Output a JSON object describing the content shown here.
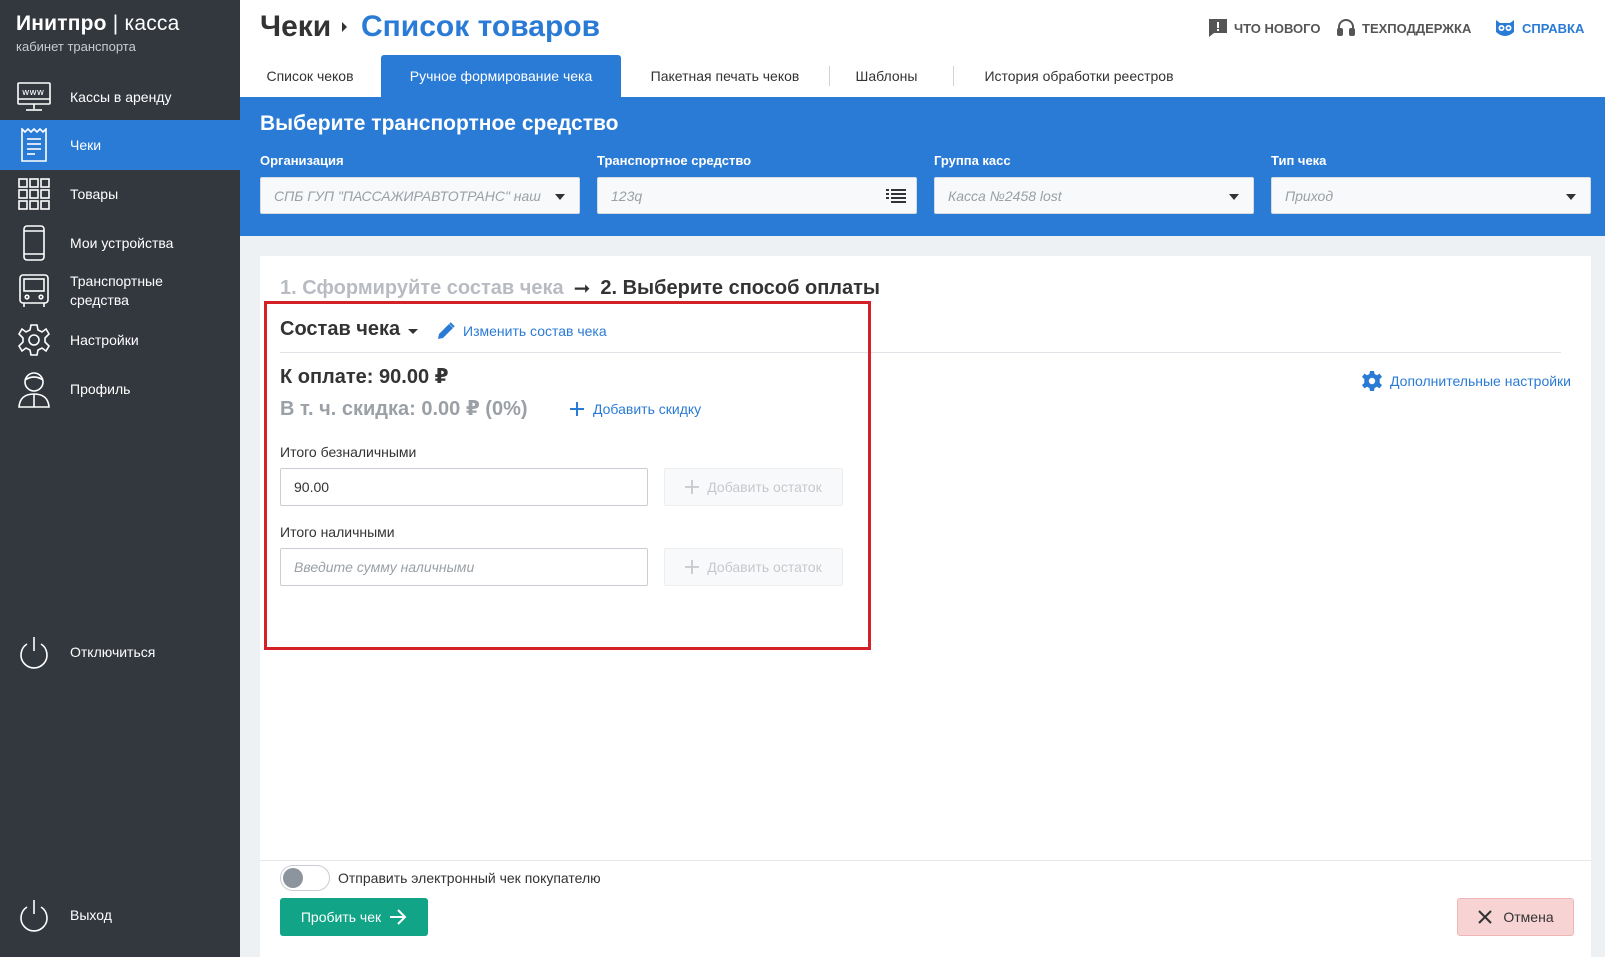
{
  "brand": {
    "name": "Инитпро",
    "separator": "|",
    "product": "касса",
    "subtitle": "кабинет транспорта"
  },
  "sidebar": {
    "items": [
      {
        "label": "Кассы в аренду",
        "icon": "www-monitor-icon"
      },
      {
        "label": "Чеки",
        "icon": "receipt-icon",
        "active": true
      },
      {
        "label": "Товары",
        "icon": "grid-icon"
      },
      {
        "label": "Мои устройства",
        "icon": "phone-icon"
      },
      {
        "label": "Транспортные средства",
        "icon": "bus-icon"
      },
      {
        "label": "Настройки",
        "icon": "gear-icon"
      },
      {
        "label": "Профиль",
        "icon": "user-icon"
      }
    ],
    "disconnect": "Отключиться",
    "logout": "Выход"
  },
  "header": {
    "breadcrumb_root": "Чеки",
    "breadcrumb_current": "Список товаров",
    "links": {
      "whats_new": "ЧТО НОВОГО",
      "support": "ТЕХПОДДЕРЖКА",
      "help": "СПРАВКА"
    }
  },
  "tabs": [
    {
      "label": "Список чеков"
    },
    {
      "label": "Ручное формирование чека",
      "active": true
    },
    {
      "label": "Пакетная печать чеков"
    },
    {
      "label": "Шаблоны"
    },
    {
      "label": "История обработки реестров"
    }
  ],
  "vehicle": {
    "title": "Выберите транспортное средство",
    "fields": [
      {
        "label": "Организация",
        "value": "СПБ ГУП \"ПАССАЖИРАВТОТРАНС\" наш"
      },
      {
        "label": "Транспортное средство",
        "value": "123q"
      },
      {
        "label": "Группа касс",
        "value": "Касса №2458 lost"
      },
      {
        "label": "Тип чека",
        "value": "Приход"
      }
    ]
  },
  "steps": {
    "step1": "1. Сформируйте состав чека",
    "arrow": "➞",
    "step2": "2. Выберите способ оплаты"
  },
  "composition": {
    "title": "Состав чека",
    "edit_link": "Изменить состав чека",
    "to_pay": "К оплате: 90.00 ₽",
    "discount": "В т. ч. скидка: 0.00 ₽ (0%)",
    "add_discount": "Добавить скидку",
    "extra_settings": "Дополнительные настройки"
  },
  "payment": {
    "cashless_label": "Итого безналичными",
    "cashless_value": "90.00",
    "cash_label": "Итого наличными",
    "cash_placeholder": "Введите сумму наличными",
    "add_rest": "Добавить остаток"
  },
  "footer": {
    "send_receipt_label": "Отправить электронный чек покупателю",
    "send_receipt_enabled": false,
    "submit": "Пробить чек",
    "cancel": "Отмена"
  },
  "colors": {
    "accent": "#2a7bd5",
    "sidebar": "#33373e",
    "submit": "#12a487",
    "cancel": "#f7d3d3",
    "highlight": "#d42027"
  }
}
